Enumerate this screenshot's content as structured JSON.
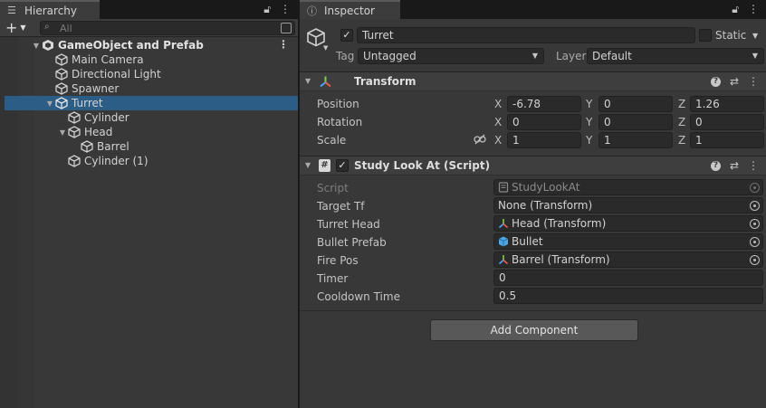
{
  "hierarchy": {
    "tab_label": "Hierarchy",
    "search_placeholder": "All",
    "items": [
      {
        "label": "GameObject and Prefab",
        "depth": 0,
        "expanded": true,
        "scene": true
      },
      {
        "label": "Main Camera",
        "depth": 1
      },
      {
        "label": "Directional Light",
        "depth": 1
      },
      {
        "label": "Spawner",
        "depth": 1
      },
      {
        "label": "Turret",
        "depth": 1,
        "expanded": true,
        "selected": true
      },
      {
        "label": "Cylinder",
        "depth": 2
      },
      {
        "label": "Head",
        "depth": 2,
        "expanded": true
      },
      {
        "label": "Barrel",
        "depth": 3
      },
      {
        "label": "Cylinder (1)",
        "depth": 2
      }
    ]
  },
  "inspector": {
    "tab_label": "Inspector",
    "object": {
      "name": "Turret",
      "active": true,
      "static_label": "Static",
      "tag_label": "Tag",
      "tag_value": "Untagged",
      "layer_label": "Layer",
      "layer_value": "Default"
    },
    "transform": {
      "title": "Transform",
      "position": {
        "label": "Position",
        "x": "-6.78",
        "y": "0",
        "z": "1.26"
      },
      "rotation": {
        "label": "Rotation",
        "x": "0",
        "y": "0",
        "z": "0"
      },
      "scale": {
        "label": "Scale",
        "x": "1",
        "y": "1",
        "z": "1"
      },
      "axis_x": "X",
      "axis_y": "Y",
      "axis_z": "Z"
    },
    "script_component": {
      "title": "Study Look At (Script)",
      "enabled": true,
      "fields": {
        "script": {
          "label": "Script",
          "value": "StudyLookAt"
        },
        "target_tf": {
          "label": "Target Tf",
          "value": "None (Transform)"
        },
        "turret_head": {
          "label": "Turret Head",
          "value": "Head (Transform)"
        },
        "bullet_prefab": {
          "label": "Bullet Prefab",
          "value": "Bullet"
        },
        "fire_pos": {
          "label": "Fire Pos",
          "value": "Barrel (Transform)"
        },
        "timer": {
          "label": "Timer",
          "value": "0"
        },
        "cooldown_time": {
          "label": "Cooldown Time",
          "value": "0.5"
        }
      }
    },
    "add_component_label": "Add Component"
  },
  "colors": {
    "selection": "#2c5d87",
    "panel": "#383838",
    "field": "#2a2a2a"
  }
}
